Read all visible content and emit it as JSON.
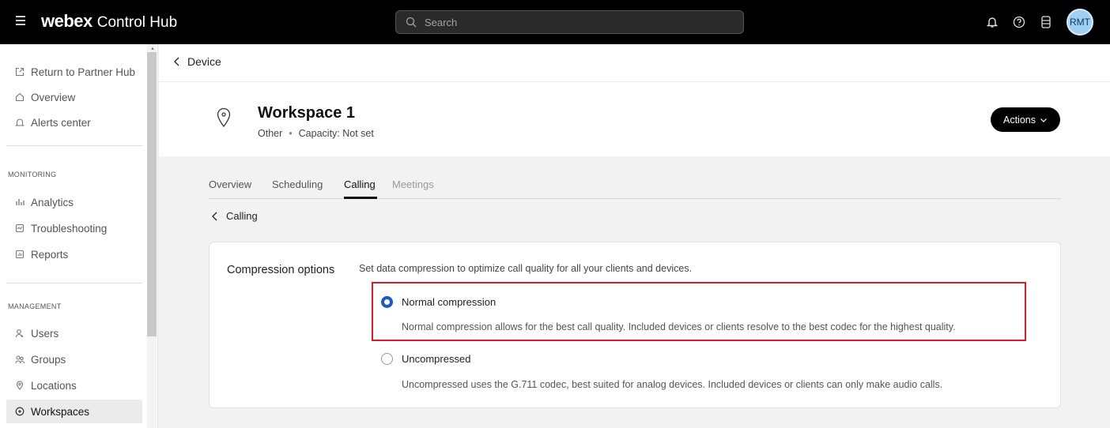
{
  "topbar": {
    "brand_logo": "webex",
    "brand_product": "Control Hub",
    "search_placeholder": "Search",
    "avatar_initials": "RMT"
  },
  "sidebar": {
    "top_items": [
      {
        "label": "Return to Partner Hub",
        "icon": "external-link-icon"
      },
      {
        "label": "Overview",
        "icon": "home-icon"
      },
      {
        "label": "Alerts center",
        "icon": "bell-icon"
      }
    ],
    "monitoring_label": "MONITORING",
    "monitoring_items": [
      {
        "label": "Analytics",
        "icon": "analytics-icon"
      },
      {
        "label": "Troubleshooting",
        "icon": "troubleshooting-icon"
      },
      {
        "label": "Reports",
        "icon": "reports-icon"
      }
    ],
    "management_label": "MANAGEMENT",
    "management_items": [
      {
        "label": "Users",
        "icon": "user-icon"
      },
      {
        "label": "Groups",
        "icon": "groups-icon"
      },
      {
        "label": "Locations",
        "icon": "location-icon"
      },
      {
        "label": "Workspaces",
        "icon": "workspace-icon",
        "active": true
      }
    ]
  },
  "header": {
    "back_label": "Device",
    "title": "Workspace 1",
    "type": "Other",
    "capacity": "Capacity: Not set",
    "actions_label": "Actions"
  },
  "tabs": [
    {
      "label": "Overview",
      "state": "normal"
    },
    {
      "label": "Scheduling",
      "state": "normal"
    },
    {
      "label": "Calling",
      "state": "active"
    },
    {
      "label": "Meetings",
      "state": "disabled"
    }
  ],
  "sub_back_label": "Calling",
  "compression": {
    "label": "Compression options",
    "description": "Set data compression to optimize call quality for all your clients and devices.",
    "options": [
      {
        "label": "Normal compression",
        "description": "Normal compression allows for the best call quality. Included devices or clients resolve to the best codec for the highest quality.",
        "selected": true
      },
      {
        "label": "Uncompressed",
        "description": "Uncompressed uses the G.711 codec, best suited for analog devices. Included devices or clients can only make audio calls.",
        "selected": false
      }
    ]
  },
  "colors": {
    "accent": "#1d58c6",
    "highlight": "#d81e2c",
    "topbar": "#000000"
  }
}
